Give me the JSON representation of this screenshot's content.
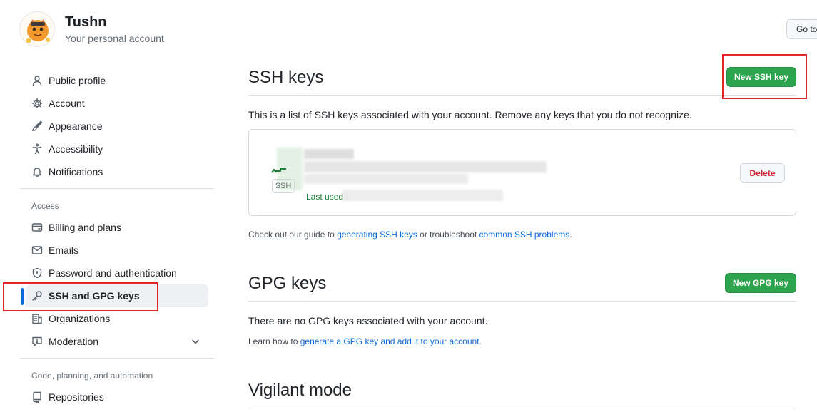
{
  "account": {
    "name": "Tushn",
    "subtitle": "Your personal account",
    "goto_label": "Go to"
  },
  "sidebar": {
    "items": [
      {
        "label": "Public profile",
        "icon": "person-icon"
      },
      {
        "label": "Account",
        "icon": "gear-icon"
      },
      {
        "label": "Appearance",
        "icon": "paintbrush-icon"
      },
      {
        "label": "Accessibility",
        "icon": "accessibility-icon"
      },
      {
        "label": "Notifications",
        "icon": "bell-icon"
      }
    ],
    "access_label": "Access",
    "access_items": [
      {
        "label": "Billing and plans",
        "icon": "credit-card-icon"
      },
      {
        "label": "Emails",
        "icon": "mail-icon"
      },
      {
        "label": "Password and authentication",
        "icon": "shield-lock-icon"
      },
      {
        "label": "SSH and GPG keys",
        "icon": "key-icon",
        "active": true
      },
      {
        "label": "Organizations",
        "icon": "organization-icon"
      },
      {
        "label": "Moderation",
        "icon": "report-icon",
        "expandable": true
      }
    ],
    "code_label": "Code, planning, and automation",
    "code_items": [
      {
        "label": "Repositories",
        "icon": "repo-icon"
      }
    ]
  },
  "ssh": {
    "title": "SSH keys",
    "new_button": "New SSH key",
    "description": "This is a list of SSH keys associated with your account. Remove any keys that you do not recognize.",
    "key": {
      "badge": "SSH",
      "last_used": "Last used",
      "delete_label": "Delete"
    },
    "guide": {
      "prefix": "Check out our guide to ",
      "link1": "generating SSH keys",
      "middle": " or troubleshoot ",
      "link2": "common SSH problems",
      "suffix": "."
    }
  },
  "gpg": {
    "title": "GPG keys",
    "new_button": "New GPG key",
    "empty": "There are no GPG keys associated with your account.",
    "learn": {
      "prefix": "Learn how to ",
      "link": "generate a GPG key and add it to your account",
      "suffix": "."
    }
  },
  "vigilant": {
    "title": "Vigilant mode"
  },
  "colors": {
    "primary_button": "#2da44e",
    "link": "#0969da",
    "danger": "#cf222e",
    "active_indicator": "#0969da",
    "annotation_box": "#e0262b"
  }
}
